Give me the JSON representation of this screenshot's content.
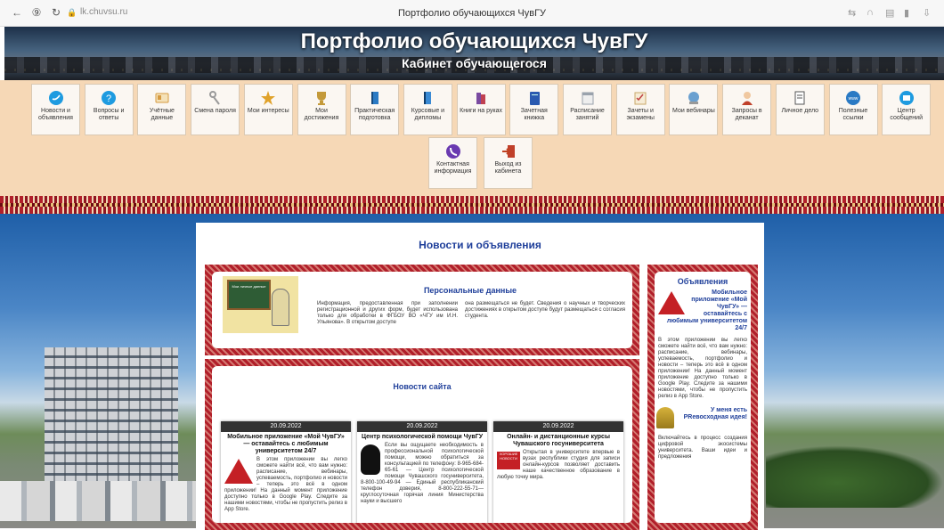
{
  "browser": {
    "url": "lk.chuvsu.ru",
    "tab_title": "Портфолио обучающихся ЧувГУ"
  },
  "header": {
    "title": "Портфолио обучающихся ЧувГУ",
    "subtitle": "Кабинет обучающегося"
  },
  "menu": {
    "row1": [
      {
        "label": "Новости и объявления",
        "icon": "twitter-icon",
        "color": "#1e9be0"
      },
      {
        "label": "Вопросы и ответы",
        "icon": "question-icon",
        "color": "#1e9be0"
      },
      {
        "label": "Учётные данные",
        "icon": "id-card-icon",
        "color": "#d69a40"
      },
      {
        "label": "Смена пароля",
        "icon": "keys-icon",
        "color": "#9a9a9a"
      },
      {
        "label": "Мои интересы",
        "icon": "star-icon",
        "color": "#e0a22a"
      },
      {
        "label": "Мои достижения",
        "icon": "trophy-icon",
        "color": "#c49a3a"
      },
      {
        "label": "Практическая подготовка",
        "icon": "book-icon",
        "color": "#2a7ac4"
      },
      {
        "label": "Курсовые и дипломы",
        "icon": "book-blue-icon",
        "color": "#3a8ad4"
      },
      {
        "label": "Книги на руках",
        "icon": "books-icon",
        "color": "#7a4aa0"
      },
      {
        "label": "Зачетная книжка",
        "icon": "record-book-icon",
        "color": "#2a5ab0"
      },
      {
        "label": "Расписание занятий",
        "icon": "schedule-icon",
        "color": "#9aa2ac"
      },
      {
        "label": "Зачеты и экзамены",
        "icon": "checklist-icon",
        "color": "#c9a86a"
      },
      {
        "label": "Мои вебинары",
        "icon": "webinar-icon",
        "color": "#6aa0d0"
      },
      {
        "label": "Запросы в деканат",
        "icon": "person-icon",
        "color": "#c0402a"
      },
      {
        "label": "Личное дело",
        "icon": "file-icon",
        "color": "#555555"
      },
      {
        "label": "Полезные ссылки",
        "icon": "www-icon",
        "color": "#2a7ac4"
      },
      {
        "label": "Центр сообщений",
        "icon": "message-icon",
        "color": "#1e9be0"
      }
    ],
    "row2": [
      {
        "label": "Контактная информация",
        "icon": "phone-icon",
        "color": "#6a3ab0"
      },
      {
        "label": "Выход из кабинета",
        "icon": "exit-icon",
        "color": "#c0402a"
      }
    ]
  },
  "main": {
    "title": "Новости и объявления",
    "personal": {
      "title": "Персональные данные",
      "image_caption": "Мои личные данные",
      "text_left": "Информация, предоставленная при заполнении регистрационной и других форм, будет использована только для обработки в ФГБОУ ВО «ЧГУ им И.Н. Ульянова». В открытом доступе",
      "text_right": "она размещаться не будет. Сведения о научных и творческих достижениях в открытом доступе будут размещаться с согласия студента."
    },
    "site_news": {
      "title": "Новости сайта",
      "cards": [
        {
          "date": "20.09.2022",
          "title": "Мобильное приложение «Мой ЧувГУ» — оставайтесь с любимым университетом 24/7",
          "text": "В этом приложении вы легко сможете найти всё, что вам нужно: расписание, вебинары, успеваемость, портфолио и новости – теперь это всё в одном приложении! На данный момент приложение доступно только в Google Play. Следите за нашими новостями, чтобы не пропустить релиз в App Store."
        },
        {
          "date": "20.09.2022",
          "title": "Центр психологической помощи ЧувГУ",
          "text": "Если вы ощущаете необходимость в профессиональной психологической помощи, можно обратиться за консультацией по телефону: 8-965-684-65-61 — Центр психологической помощи Чувашского госуниверситета, 8-800-100-49-94 — Единый республиканский телефон доверия, 8-800-222-55-71— круглосуточная горячая линия Министерства науки и высшего"
        },
        {
          "date": "20.09.2022",
          "title": "Онлайн- и дистанционные курсы Чувашского госуниверситета",
          "badge": "ХОРОШИЕ НОВОСТИ",
          "text": "Открытая в университете впервые в вузах республики студия для записи онлайн-курсов позволяет доставить наше качественное образование в любую точку мира."
        }
      ]
    }
  },
  "sidebar": {
    "title": "Объявления",
    "item1": {
      "title": "Мобильное приложение «Мой ЧувГУ» — оставайтесь с любимым университетом 24/7",
      "text": "В этом приложении вы легко сможете найти всё, что вам нужно: расписание, вебинары, успеваемость, портфолио и новости – теперь это всё в одном приложении! На данный момент приложение доступно только в Google Play. Следите за нашими новостями, чтобы не пропустить релиз в App Store."
    },
    "item2": {
      "title": "У меня есть PRевосходная идея!",
      "text": "Включайтесь в процесс создания цифровой экосистемы университета. Ваши идеи и предложения"
    }
  }
}
